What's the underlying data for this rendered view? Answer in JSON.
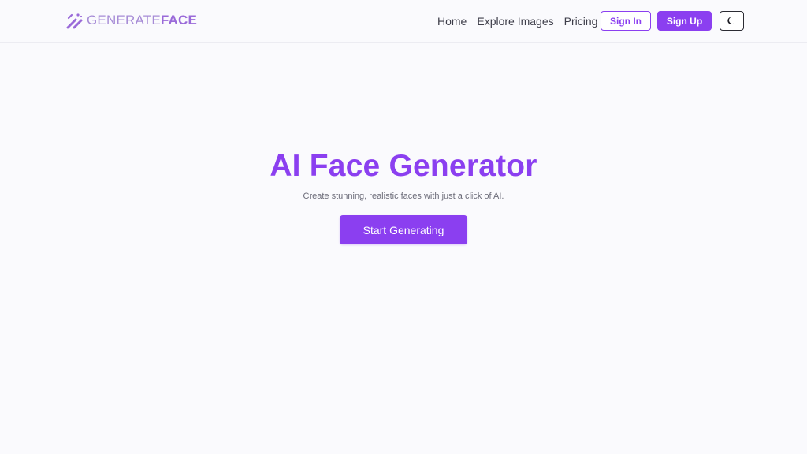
{
  "header": {
    "logo": {
      "text_light": "GENERATE",
      "text_bold": "FACE",
      "icon": "magic-wand-icon"
    },
    "nav": [
      {
        "label": "Home"
      },
      {
        "label": "Explore Images"
      },
      {
        "label": "Pricing"
      }
    ],
    "sign_in_label": "Sign In",
    "sign_up_label": "Sign Up",
    "theme_toggle_icon": "moon-icon"
  },
  "hero": {
    "title": "AI Face Generator",
    "subtitle": "Create stunning, realistic faces with just a click of AI.",
    "cta_label": "Start Generating"
  },
  "colors": {
    "accent": "#8b3ff0",
    "background": "#fafafd",
    "nav_text": "#3e3e4a",
    "subtitle_text": "#6b6b78"
  }
}
